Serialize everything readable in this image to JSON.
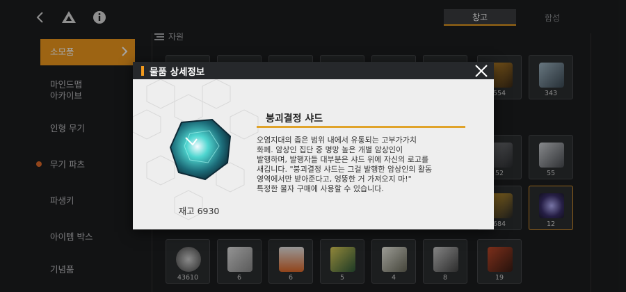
{
  "topbar": {
    "back_icon": "chevron-left-icon",
    "drive_icon": "drive-triangle-icon",
    "info_icon": "info-icon"
  },
  "tabs": [
    {
      "label": "창고",
      "active": true
    },
    {
      "label": "합성",
      "active": false
    }
  ],
  "sidebar": {
    "items": [
      {
        "label": "소모품",
        "active": true
      },
      {
        "label": "마인드맵\n아카이브",
        "active": false
      },
      {
        "label": "인형 무기",
        "active": false
      },
      {
        "label": "무기 파츠",
        "active": false
      },
      {
        "label": "파생키",
        "active": false
      },
      {
        "label": "아이템 박스",
        "active": false
      },
      {
        "label": "기념품",
        "active": false
      }
    ]
  },
  "section": {
    "label": "자원"
  },
  "grid": {
    "row1_visible_qty": [
      "554",
      "343"
    ],
    "row2_visible_qty": [
      "52",
      "55"
    ],
    "row3_visible_qty": [
      "684",
      "12"
    ],
    "bottom_row_qty": [
      "43610",
      "6",
      "6",
      "5",
      "4",
      "8",
      "19"
    ]
  },
  "modal": {
    "title": "물품 상세정보",
    "item_name": "붕괴결정 샤드",
    "stock_label": "재고 6930",
    "description": "오염지대의 좁은 범위 내에서 유통되는 고부가가치\n화폐. 암상인 집단 중 명망 높은 개별 암상인이\n발행하며, 발행자들 대부분은 샤드 위에 자신의 로고를\n새깁니다. \"붕괴결정 샤드는 그걸 발행한 암상인의 활동\n영역에서만 받아준다고, 엉뚱한 거 가져오지 마!\"\n특정한 물자 구매에 사용할 수 있습니다.",
    "accent_color": "#f29a1e"
  }
}
